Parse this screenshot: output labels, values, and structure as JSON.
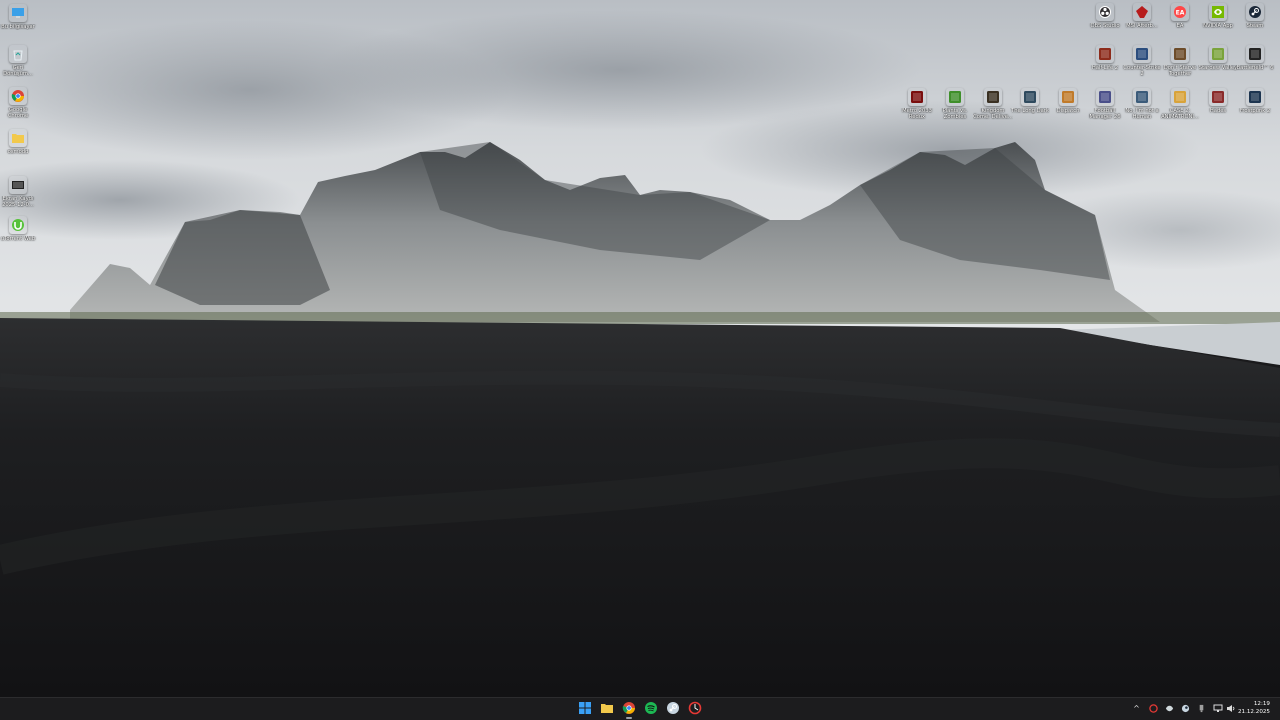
{
  "desktop": {
    "left_icons": [
      {
        "label": "Bu bilgisayar",
        "icon": "computer-icon",
        "color": "#3aa0e8"
      },
      {
        "label": "Geri Dönüşüm...",
        "icon": "recycle-bin-icon",
        "color": "#cfd8dc"
      },
      {
        "label": "Google Chrome",
        "icon": "chrome-icon",
        "color": "#4285f4"
      },
      {
        "label": "osmodd",
        "icon": "folder-icon",
        "color": "#f2c94c"
      },
      {
        "label": "Ekran Kaydı 2025-12-0...",
        "icon": "video-file-icon",
        "color": "#333333"
      },
      {
        "label": "uTorrent Web",
        "icon": "utorrent-icon",
        "color": "#57c23a"
      }
    ],
    "right_row1": [
      {
        "label": "OBS Studio",
        "icon": "obs-icon",
        "color": "#302e31"
      },
      {
        "label": "MSI Afterb...",
        "icon": "msi-icon",
        "color": "#b71c1c"
      },
      {
        "label": "EA",
        "icon": "ea-icon",
        "color": "#ff4747"
      },
      {
        "label": "NVIDIA App",
        "icon": "nvidia-icon",
        "color": "#76b900"
      },
      {
        "label": "Steam",
        "icon": "steam-icon",
        "color": "#1b2838"
      }
    ],
    "right_row2": [
      {
        "label": "Half-Life 2",
        "icon": "game-icon",
        "color": "#8d2b1b"
      },
      {
        "label": "Counter-Strike 2",
        "icon": "game-icon",
        "color": "#2b4d7e"
      },
      {
        "label": "Don't Starve Together",
        "icon": "game-icon",
        "color": "#6d4c2a"
      },
      {
        "label": "Stardew Valley",
        "icon": "game-icon",
        "color": "#7aa33b"
      },
      {
        "label": "Battlefield™ 6",
        "icon": "game-icon",
        "color": "#222222"
      }
    ],
    "right_row3": [
      {
        "label": "Metro 2033 Redux",
        "icon": "game-icon",
        "color": "#7a0e0e"
      },
      {
        "label": "Plants vs. Zombies",
        "icon": "game-icon",
        "color": "#3f8f2a"
      },
      {
        "label": "Kingdom Come: Delive...",
        "icon": "game-icon",
        "color": "#3a3022"
      },
      {
        "label": "The Long Dark",
        "icon": "game-icon",
        "color": "#2f4a5e"
      },
      {
        "label": "Dispatch",
        "icon": "game-icon",
        "color": "#c07a2a"
      },
      {
        "label": "Football Manager 26",
        "icon": "game-icon",
        "color": "#4a4f8a"
      },
      {
        "label": "No, I'm not a Human",
        "icon": "game-icon",
        "color": "#3b5b7a"
      },
      {
        "label": "CASE 2: ANIMATRONI...",
        "icon": "game-icon",
        "color": "#d8a33a"
      },
      {
        "label": "Hades",
        "icon": "game-icon",
        "color": "#8a2a2a"
      },
      {
        "label": "Frostpunk 2",
        "icon": "game-icon",
        "color": "#1d3550"
      }
    ]
  },
  "taskbar": {
    "apps": [
      {
        "name": "start-button",
        "icon": "windows-icon",
        "color": "#3aa0f5",
        "active": false
      },
      {
        "name": "file-explorer",
        "icon": "folder-icon",
        "color": "#f2c94c",
        "active": false
      },
      {
        "name": "chrome",
        "icon": "chrome-icon",
        "color": "#4285f4",
        "active": true
      },
      {
        "name": "spotify",
        "icon": "spotify-icon",
        "color": "#1db954",
        "active": false
      },
      {
        "name": "steam",
        "icon": "steam-icon",
        "color": "#c7d5e0",
        "active": false
      },
      {
        "name": "red-app",
        "icon": "app-icon",
        "color": "#e53935",
        "active": false
      }
    ],
    "tray": {
      "chevron": "^",
      "time": "12:19",
      "date": "21.12.2025"
    }
  }
}
